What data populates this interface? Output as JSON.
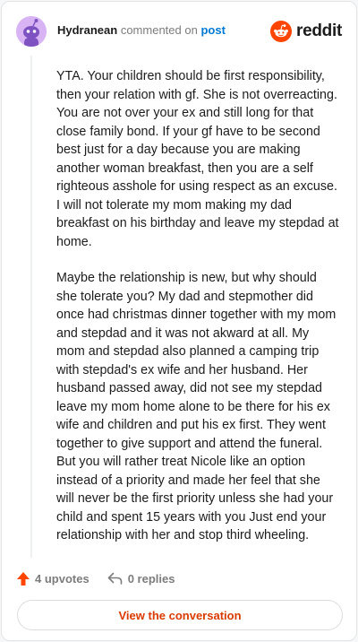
{
  "header": {
    "username": "Hydranean",
    "action_text": "commented on",
    "post_link": "post",
    "logo_text": "reddit"
  },
  "comment": {
    "paragraphs": [
      "YTA. Your children should be first responsibility, then your relation with gf. She is not overreacting. You are not over your ex and still long for that close family bond. If your gf have to be second best just for a day because you are making another woman breakfast, then you are a self righteous asshole for using respect as an excuse. I will not tolerate my mom making my dad breakfast on his birthday and leave my stepdad at home.",
      "Maybe the relationship is new, but why should she tolerate you? My dad and stepmother did once had christmas dinner together with my mom and stepdad and it was not akward at all. My mom and stepdad also planned a camping trip with stepdad's ex wife and her husband. Her husband passed away, did not see my stepdad leave my mom home alone to be there for his ex wife and children and put his ex first. They went together to give support and attend the funeral. But you will rather treat Nicole like an option instead of a priority and made her feel that she will never be the first priority unless she had your child and spent 15 years with you Just end your relationship with her and stop third wheeling."
    ]
  },
  "actions": {
    "upvotes_label": "4 upvotes",
    "replies_label": "0 replies"
  },
  "cta": {
    "label": "View the conversation"
  },
  "colors": {
    "accent_orange": "#ff4500",
    "link_blue": "#0079d3",
    "cta_text": "#d93a00",
    "avatar_bg": "#d8b4f5"
  },
  "icons": {
    "avatar": "snoo-avatar-icon",
    "logo": "reddit-logo-icon",
    "upvote": "upvote-arrow-icon",
    "reply": "reply-arrow-icon"
  }
}
